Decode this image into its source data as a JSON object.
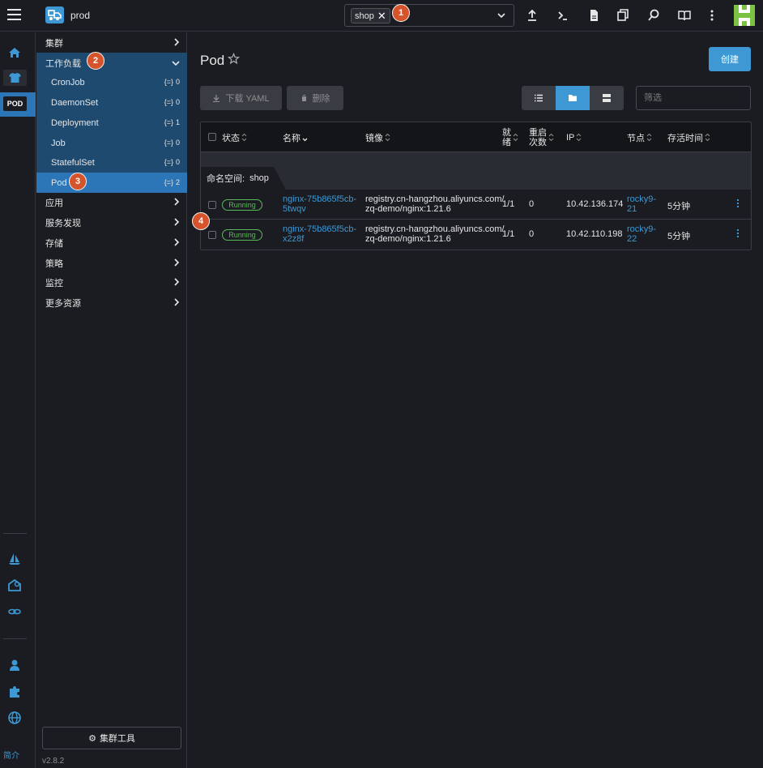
{
  "header": {
    "cluster_name": "prod",
    "namespace_chip": "shop",
    "icons": [
      "upload-icon",
      "terminal-icon",
      "file-icon",
      "copy-icon",
      "search-icon",
      "book-icon",
      "more-vertical-icon"
    ],
    "avatar_color": "#7cc242"
  },
  "badges": [
    "1",
    "2",
    "3",
    "4"
  ],
  "rail": {
    "pod_label": "POD",
    "footer": "简介"
  },
  "sidebar": {
    "groups": [
      "集群",
      "工作负载",
      "应用",
      "服务发现",
      "存储",
      "策略",
      "监控",
      "更多资源"
    ],
    "workload_items": [
      {
        "label": "CronJob",
        "count": "0"
      },
      {
        "label": "DaemonSet",
        "count": "0"
      },
      {
        "label": "Deployment",
        "count": "1"
      },
      {
        "label": "Job",
        "count": "0"
      },
      {
        "label": "StatefulSet",
        "count": "0"
      },
      {
        "label": "Pod",
        "count": "2"
      }
    ],
    "tool_button": "集群工具",
    "version": "v2.8.2"
  },
  "main": {
    "title": "Pod",
    "create_label": "创建",
    "download_yaml": "下载 YAML",
    "delete_label": "删除",
    "filter_placeholder": "筛选",
    "columns": {
      "state": "状态",
      "name": "名称",
      "image": "镜像",
      "ready_a": "就",
      "ready_b": "绪",
      "restarts_a": "重启",
      "restarts_b": "次数",
      "ip": "IP",
      "node": "节点",
      "age": "存活时间"
    },
    "namespace_group": {
      "label": "命名空间:",
      "value": "shop"
    },
    "rows": [
      {
        "state": "Running",
        "name_a": "nginx-75b865f5cb-",
        "name_b": "5twqv",
        "image_a": "registry.cn-hangzhou.aliyuncs.com/",
        "image_b": "zq-demo/nginx:1.21.6",
        "ready": "1/1",
        "restarts": "0",
        "ip": "10.42.136.174",
        "node_a": "rocky9-",
        "node_b": "21",
        "age": "5分钟"
      },
      {
        "state": "Running",
        "name_a": "nginx-75b865f5cb-",
        "name_b": "x2z8f",
        "image_a": "registry.cn-hangzhou.aliyuncs.com/",
        "image_b": "zq-demo/nginx:1.21.6",
        "ready": "1/1",
        "restarts": "0",
        "ip": "10.42.110.198",
        "node_a": "rocky9-",
        "node_b": "22",
        "age": "5分钟"
      }
    ]
  },
  "colors": {
    "accent": "#3d98d3",
    "badge": "#d6542c",
    "running": "#5bb85b"
  }
}
